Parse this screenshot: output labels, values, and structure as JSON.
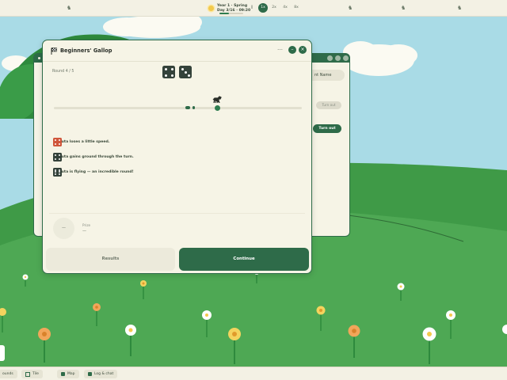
{
  "topbar": {
    "date_line1": "Year 1 · Spring",
    "date_line2": "Day 3/16 · 09:20",
    "speeds": [
      "‖",
      "1x",
      "2x",
      "4x",
      "8x"
    ],
    "active_speed": "1x"
  },
  "dialog": {
    "title": "Beginners' Gallop",
    "round": "Round 4 / 5",
    "dice_faces": [
      4,
      3
    ],
    "events": [
      {
        "text": "Rauta loses a little speed.",
        "dice": [
          4,
          4
        ],
        "style": "red"
      },
      {
        "text": "Rauta gains ground through the turn.",
        "dice": [
          4,
          4
        ],
        "style": "dark"
      },
      {
        "text": "Rauta is flying — an incredible round!",
        "dice": [
          6,
          6
        ],
        "style": "dark"
      }
    ],
    "prize_value": "—",
    "prize_label": "Prize",
    "prize_amount": "—",
    "results_label": "Results",
    "continue_label": "Continue"
  },
  "back_window": {
    "name_label": "nt  Name",
    "turn_out_disabled": "Turn out",
    "turn_out": "Turn out"
  },
  "bottombar": {
    "items": [
      "ounds",
      "Tile",
      "Map",
      "Log & chat"
    ]
  },
  "colors": {
    "accent": "#2e6b49",
    "sky": "#a9dbe6",
    "grass": "#4ea854",
    "die_red": "#d0563b"
  }
}
